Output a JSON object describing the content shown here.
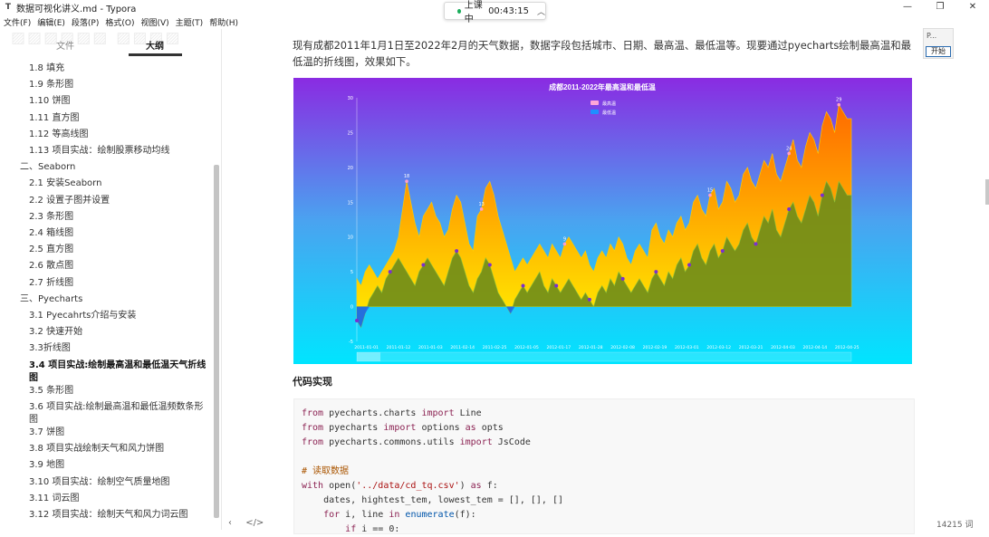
{
  "window": {
    "title": "数据可视化讲义.md - Typora",
    "app_icon": "T",
    "minimize": "—",
    "maximize": "❐",
    "close": "✕"
  },
  "menu": [
    "文件(F)",
    "编辑(E)",
    "段落(P)",
    "格式(O)",
    "视图(V)",
    "主题(T)",
    "帮助(H)"
  ],
  "meeting": {
    "status": "上课中",
    "time": "00:43:15"
  },
  "sidebar": {
    "tab_files": "文件",
    "tab_outline": "大纲",
    "items": [
      {
        "label": "1.8 填充",
        "level": 2
      },
      {
        "label": "1.9 条形图",
        "level": 2
      },
      {
        "label": "1.10 饼图",
        "level": 2
      },
      {
        "label": "1.11 直方图",
        "level": 2
      },
      {
        "label": "1.12 等高线图",
        "level": 2
      },
      {
        "label": "1.13 项目实战：绘制股票移动均线",
        "level": 2
      },
      {
        "label": "二、Seaborn",
        "level": 1
      },
      {
        "label": "2.1 安装Seaborn",
        "level": 2
      },
      {
        "label": "2.2 设置子图并设置",
        "level": 2
      },
      {
        "label": "2.3 条形图",
        "level": 2
      },
      {
        "label": "2.4 箱线图",
        "level": 2
      },
      {
        "label": "2.5 直方图",
        "level": 2
      },
      {
        "label": "2.6 散点图",
        "level": 2
      },
      {
        "label": "2.7 折线图",
        "level": 2
      },
      {
        "label": "三、Pyecharts",
        "level": 1
      },
      {
        "label": "3.1 Pyecahrts介绍与安装",
        "level": 2
      },
      {
        "label": "3.2 快速开始",
        "level": 2
      },
      {
        "label": "3.3折线图",
        "level": 2
      },
      {
        "label": "3.4 项目实战:绘制最高温和最低温天气折线",
        "level": 2,
        "active": true
      },
      {
        "label": "图",
        "level": 2,
        "active": true,
        "cont": true
      },
      {
        "label": "3.5 条形图",
        "level": 2
      },
      {
        "label": "3.6 项目实战:绘制最高温和最低温频数条形",
        "level": 2
      },
      {
        "label": "图",
        "level": 2,
        "cont": true
      },
      {
        "label": "3.7 饼图",
        "level": 2
      },
      {
        "label": "3.8 项目实战绘制天气和风力饼图",
        "level": 2
      },
      {
        "label": "3.9 地图",
        "level": 2
      },
      {
        "label": "3.10 项目实战：绘制空气质量地图",
        "level": 2
      },
      {
        "label": "3.11 词云图",
        "level": 2
      },
      {
        "label": "3.12 项目实战：绘制天气和风力词云图",
        "level": 2
      }
    ],
    "bottom_left": "‹",
    "bottom_code": "</>"
  },
  "main": {
    "intro": "现有成都2011年1月1日至2022年2月的天气数据，数据字段包括城市、日期、最高温、最低温等。现要通过pyecharts绘制最高温和最低温的折线图，效果如下。",
    "code_heading": "代码实现",
    "code_lines": [
      [
        [
          "kw",
          "from"
        ],
        [
          "t",
          " pyecharts.charts "
        ],
        [
          "kw",
          "import"
        ],
        [
          "t",
          " Line"
        ]
      ],
      [
        [
          "kw",
          "from"
        ],
        [
          "t",
          " pyecharts "
        ],
        [
          "kw",
          "import"
        ],
        [
          "t",
          " options "
        ],
        [
          "kw",
          "as"
        ],
        [
          "t",
          " opts"
        ]
      ],
      [
        [
          "kw",
          "from"
        ],
        [
          "t",
          " pyecharts.commons.utils "
        ],
        [
          "kw",
          "import"
        ],
        [
          "t",
          " JsCode"
        ]
      ],
      [],
      [
        [
          "cm",
          "# 读取数据"
        ]
      ],
      [
        [
          "kw",
          "with"
        ],
        [
          "t",
          " open("
        ],
        [
          "st",
          "'../data/cd_tq.csv'"
        ],
        [
          "t",
          ") "
        ],
        [
          "kw",
          "as"
        ],
        [
          "t",
          " f:"
        ]
      ],
      [
        [
          "t",
          "    dates, hightest_tem, lowest_tem = [], [], []"
        ]
      ],
      [
        [
          "t",
          "    "
        ],
        [
          "kw",
          "for"
        ],
        [
          "t",
          " i, line "
        ],
        [
          "kw",
          "in"
        ],
        [
          "t",
          " "
        ],
        [
          "fn",
          "enumerate"
        ],
        [
          "t",
          "(f):"
        ]
      ],
      [
        [
          "t",
          "        "
        ],
        [
          "kw",
          "if"
        ],
        [
          "t",
          " i == 0:"
        ]
      ]
    ],
    "word_count": "14215 词"
  },
  "widget": {
    "label": "P...",
    "start": "开始"
  },
  "chart_data": {
    "type": "area",
    "title": "成都2011-2022年最高温和最低温",
    "legend": [
      "最高温",
      "最低温"
    ],
    "legend_position": "top-center",
    "ylim": [
      -5,
      30
    ],
    "yticks": [
      "30",
      "25",
      "20",
      "15",
      "10",
      "5",
      "0",
      "-5"
    ],
    "x_labels": [
      "2011-01-01",
      "2011-01-12",
      "2011-01-03",
      "2011-02-14",
      "2011-02-25",
      "2012-01-05",
      "2012-01-17",
      "2012-01-28",
      "2012-02-08",
      "2012-02-19",
      "2012-03-01",
      "2012-03-12",
      "2012-03-21",
      "2012-04-03",
      "2012-04-14",
      "2012-04-25"
    ],
    "series": [
      {
        "name": "最高温",
        "color_top": "#ff7a00",
        "color_bottom": "#ffe100",
        "values": [
          4,
          3,
          5,
          6,
          5,
          4,
          5,
          6,
          7,
          8,
          10,
          14,
          18,
          15,
          12,
          10,
          13,
          14,
          15,
          13,
          12,
          10,
          11,
          14,
          16,
          15,
          12,
          9,
          8,
          13,
          14,
          17,
          18,
          16,
          13,
          11,
          9,
          7,
          5,
          6,
          7,
          6,
          7,
          8,
          9,
          8,
          7,
          9,
          8,
          7,
          9,
          10,
          9,
          8,
          7,
          8,
          6,
          5,
          7,
          8,
          7,
          9,
          8,
          10,
          9,
          7,
          6,
          8,
          9,
          8,
          7,
          11,
          12,
          10,
          9,
          11,
          10,
          12,
          13,
          11,
          12,
          15,
          16,
          14,
          13,
          16,
          17,
          14,
          15,
          18,
          17,
          15,
          16,
          19,
          20,
          18,
          17,
          19,
          21,
          20,
          22,
          19,
          18,
          20,
          22,
          24,
          21,
          20,
          23,
          25,
          24,
          22,
          26,
          28,
          27,
          25,
          29,
          28,
          27,
          27
        ]
      },
      {
        "name": "最低温",
        "color_top": "#6e8c1a",
        "color_bottom": "#6e8c1a",
        "values": [
          -2,
          -3,
          -1,
          1,
          2,
          3,
          2,
          4,
          5,
          6,
          7,
          6,
          5,
          4,
          3,
          5,
          6,
          7,
          6,
          5,
          4,
          3,
          5,
          7,
          8,
          7,
          5,
          3,
          2,
          4,
          5,
          7,
          6,
          4,
          2,
          1,
          0,
          -1,
          1,
          2,
          3,
          2,
          3,
          4,
          5,
          3,
          2,
          4,
          3,
          2,
          3,
          4,
          3,
          2,
          1,
          2,
          1,
          0,
          2,
          3,
          2,
          4,
          3,
          5,
          4,
          3,
          2,
          3,
          4,
          3,
          2,
          4,
          5,
          4,
          3,
          5,
          4,
          6,
          7,
          5,
          6,
          8,
          9,
          7,
          6,
          8,
          9,
          7,
          8,
          10,
          9,
          8,
          9,
          11,
          12,
          10,
          9,
          11,
          13,
          12,
          14,
          11,
          10,
          12,
          14,
          15,
          13,
          12,
          14,
          16,
          15,
          13,
          16,
          18,
          17,
          15,
          18,
          17,
          16,
          16
        ]
      }
    ],
    "labeled_points": [
      {
        "series": "最高温",
        "index": 12,
        "value": "18"
      },
      {
        "series": "最高温",
        "index": 30,
        "value": "13"
      },
      {
        "series": "最高温",
        "index": 50,
        "value": "9"
      },
      {
        "series": "最高温",
        "index": 85,
        "value": "15"
      },
      {
        "series": "最高温",
        "index": 104,
        "value": "24"
      },
      {
        "series": "最高温",
        "index": 116,
        "value": "29"
      }
    ]
  }
}
